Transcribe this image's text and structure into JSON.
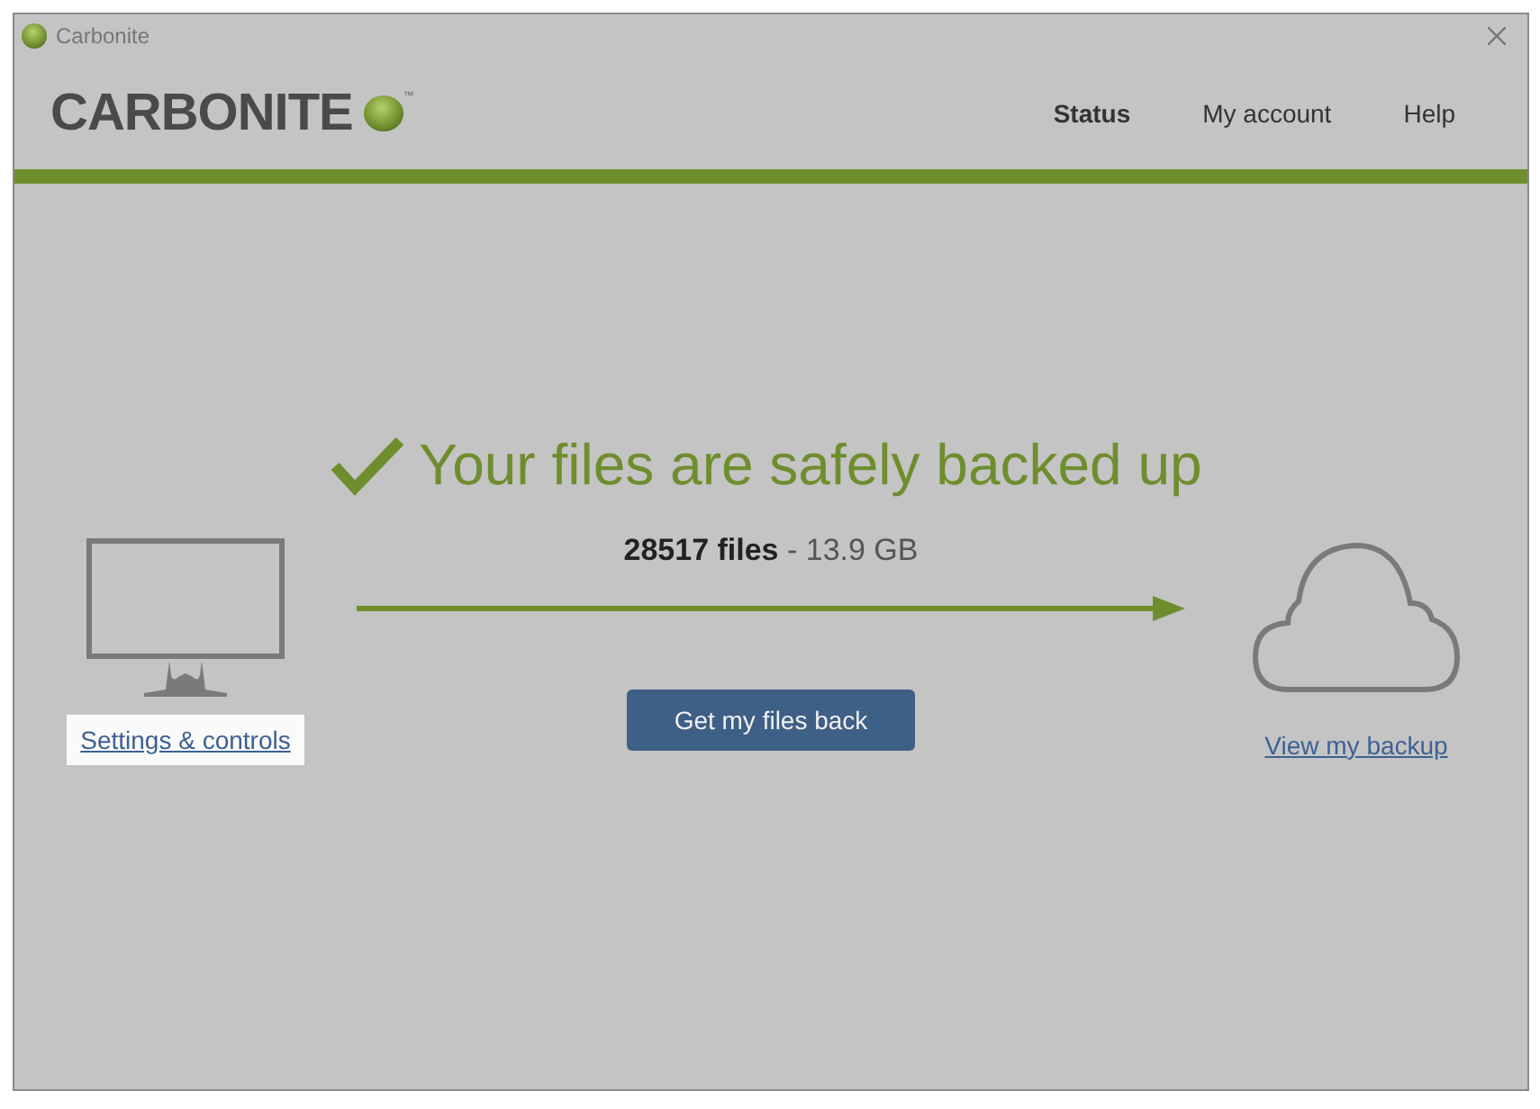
{
  "window": {
    "title": "Carbonite"
  },
  "logo": {
    "text": "CARBONITE",
    "trademark": "™"
  },
  "nav": [
    {
      "label": "Status",
      "selected": true
    },
    {
      "label": "My account",
      "selected": false
    },
    {
      "label": "Help",
      "selected": false
    }
  ],
  "status": {
    "heading": "Your files are safely backed up",
    "summary": "**28517 files** - 13.9 GB"
  },
  "computer": {
    "link": "Settings & controls",
    "highlighted": true
  },
  "restore_button": "Get my files back",
  "cloud": {
    "link": "View my backup",
    "highlighted": false
  }
}
